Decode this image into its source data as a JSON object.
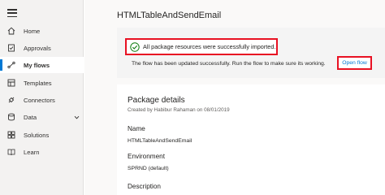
{
  "sidebar": {
    "items": [
      {
        "label": "Home",
        "icon": "home-icon"
      },
      {
        "label": "Approvals",
        "icon": "approvals-icon"
      },
      {
        "label": "My flows",
        "icon": "flow-icon",
        "active": true
      },
      {
        "label": "Templates",
        "icon": "templates-icon"
      },
      {
        "label": "Connectors",
        "icon": "connectors-icon"
      },
      {
        "label": "Data",
        "icon": "data-icon",
        "has_chevron": true
      },
      {
        "label": "Solutions",
        "icon": "solutions-icon"
      },
      {
        "label": "Learn",
        "icon": "learn-icon"
      }
    ]
  },
  "main": {
    "title": "HTMLTableAndSendEmail",
    "banner": {
      "success_text": "All package resources were successfully imported.",
      "updated_text": "The flow has been updated successfully. Run the flow to make sure its working.",
      "open_flow_link": "Open flow"
    },
    "details": {
      "title": "Package details",
      "created_by": "Created by Habibur Rahaman on 08/01/2019",
      "name_label": "Name",
      "name_value": "HTMLTableAndSendEmail",
      "environment_label": "Environment",
      "environment_value": "SPRND (default)",
      "description_label": "Description"
    }
  },
  "colors": {
    "accent": "#0078d4",
    "highlight_border": "#e81123",
    "success": "#107c10"
  }
}
